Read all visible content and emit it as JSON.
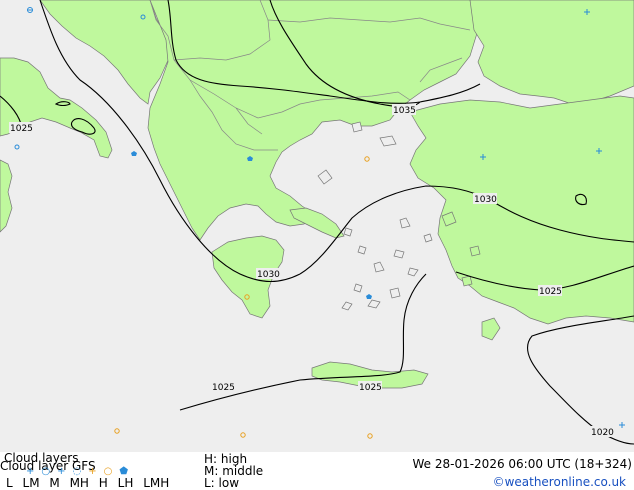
{
  "map": {
    "colors": {
      "land": "#bff89d",
      "sea": "#eeeeee",
      "border": "#888888",
      "coast": "#777777",
      "isobar": "#000000",
      "marker_blue": "#2a8cd8",
      "marker_orange": "#e8a020"
    },
    "isobars": [
      {
        "value": "1025",
        "label": "1025"
      },
      {
        "value": "1035",
        "label": "1035"
      },
      {
        "value": "1030",
        "label": "1030"
      },
      {
        "value": "1030",
        "label": "1030"
      },
      {
        "value": "1025",
        "label": "1025"
      },
      {
        "value": "1025",
        "label": "1025"
      },
      {
        "value": "1025",
        "label": "1025"
      },
      {
        "value": "1020",
        "label": "1020"
      }
    ]
  },
  "footer": {
    "title_line1": "Cloud layers",
    "title_line2": "Cloud layer  GFS",
    "level_labels": [
      "L",
      "LM",
      "M",
      "MH",
      "H",
      "LH",
      "LMH"
    ],
    "legend": [
      "H: high",
      "M: middle",
      "L: low"
    ],
    "datetime": "We 28-01-2026 06:00 UTC (18+324)",
    "copyright": "©weatheronline.co.uk"
  }
}
